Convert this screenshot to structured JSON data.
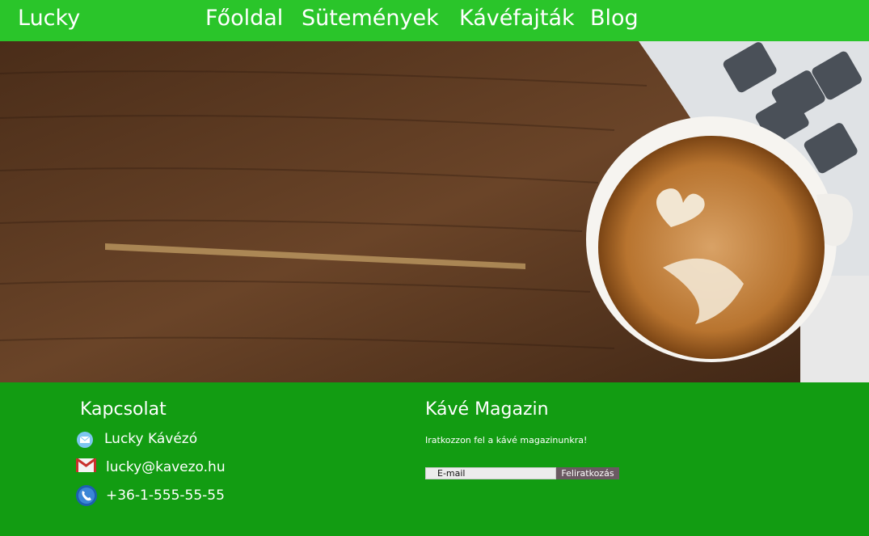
{
  "nav": {
    "brand": "Lucky",
    "links": [
      "Főoldal",
      "Sütemények",
      "Kávéfajták",
      "Blog"
    ]
  },
  "contact": {
    "title": "Kapcsolat",
    "name": "Lucky Kávézó",
    "email": "lucky@kavezo.hu",
    "phone": "+36-1-555-55-55"
  },
  "magazine": {
    "title": "Kávé Magazin",
    "subtitle": "Iratkozzon fel a kávé magazinunkra!",
    "email_placeholder": "E-mail",
    "button": "Feliratkozás"
  },
  "colors": {
    "nav": "#2ac52a",
    "footer": "#129c12"
  }
}
